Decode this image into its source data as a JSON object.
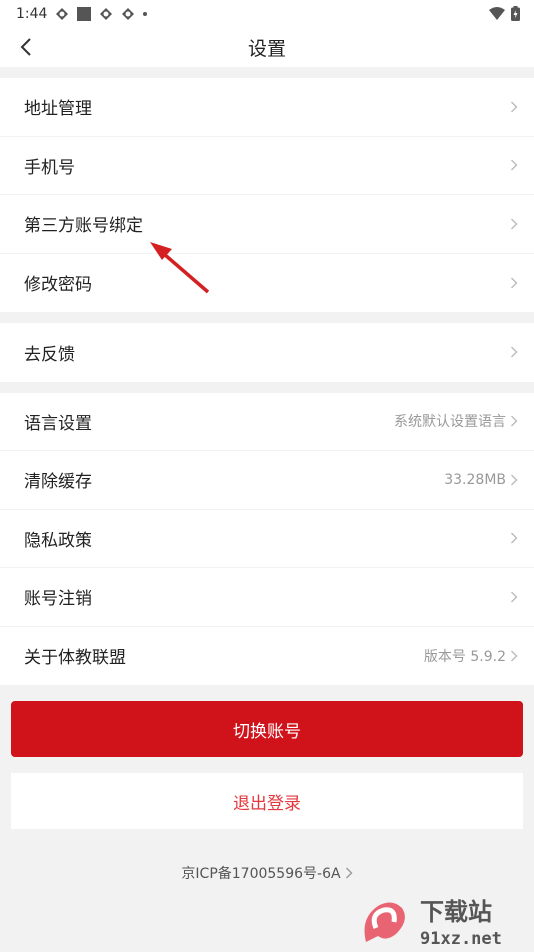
{
  "status_bar": {
    "time": "1:44"
  },
  "header": {
    "title": "设置"
  },
  "groups": [
    [
      {
        "label": "地址管理",
        "value": ""
      },
      {
        "label": "手机号",
        "value": ""
      },
      {
        "label": "第三方账号绑定",
        "value": ""
      },
      {
        "label": "修改密码",
        "value": ""
      }
    ],
    [
      {
        "label": "去反馈",
        "value": ""
      }
    ],
    [
      {
        "label": "语言设置",
        "value": "系统默认设置语言"
      },
      {
        "label": "清除缓存",
        "value": "33.28MB"
      },
      {
        "label": "隐私政策",
        "value": ""
      },
      {
        "label": "账号注销",
        "value": ""
      },
      {
        "label": "关于体教联盟",
        "value": "版本号 5.9.2"
      }
    ]
  ],
  "buttons": {
    "switch_account": "切换账号",
    "logout": "退出登录"
  },
  "footer": {
    "icp": "京ICP备17005596号-6A"
  },
  "watermark": {
    "brand": "下载站",
    "site": "91xz.net"
  },
  "colors": {
    "accent": "#d0121b",
    "logout_text": "#e3383d",
    "annotation_arrow": "#d42020"
  }
}
